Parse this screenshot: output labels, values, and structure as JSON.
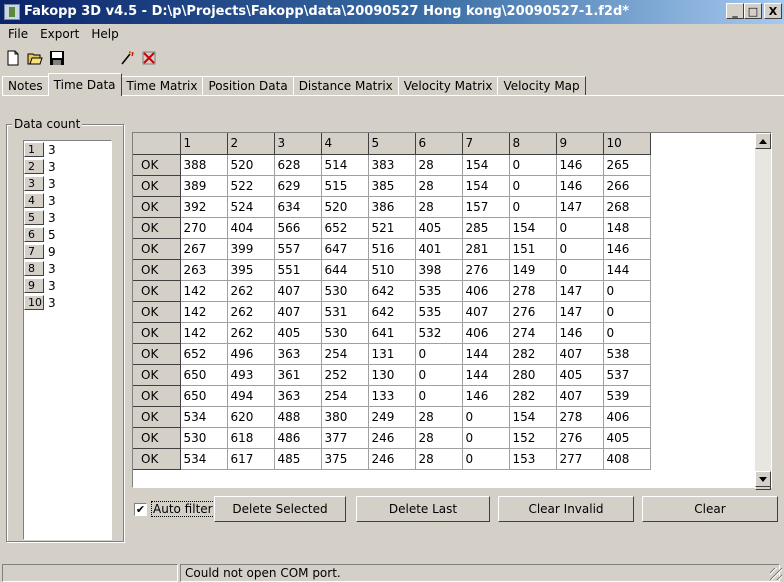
{
  "window": {
    "title": "Fakopp 3D v4.5 - D:\\p\\Projects\\Fakopp\\data\\20090527 Hong kong\\20090527-1.f2d*",
    "minimize": "_",
    "maximize": "□",
    "close": "X"
  },
  "menu": {
    "file": "File",
    "export": "Export",
    "help": "Help"
  },
  "toolbar": {
    "new_icon": "new-file-icon",
    "open_icon": "open-folder-icon",
    "save_icon": "save-disk-icon",
    "wand_icon": "connect-icon",
    "disconnect_icon": "disconnect-icon"
  },
  "tabs": [
    {
      "label": "Notes",
      "active": false
    },
    {
      "label": "Time Data",
      "active": true
    },
    {
      "label": "Time Matrix",
      "active": false
    },
    {
      "label": "Position Data",
      "active": false
    },
    {
      "label": "Distance Matrix",
      "active": false
    },
    {
      "label": "Velocity Matrix",
      "active": false
    },
    {
      "label": "Velocity Map",
      "active": false
    }
  ],
  "data_count": {
    "label": "Data count",
    "rows": [
      {
        "idx": "1",
        "val": "3"
      },
      {
        "idx": "2",
        "val": "3"
      },
      {
        "idx": "3",
        "val": "3"
      },
      {
        "idx": "4",
        "val": "3"
      },
      {
        "idx": "5",
        "val": "3"
      },
      {
        "idx": "6",
        "val": "5"
      },
      {
        "idx": "7",
        "val": "9"
      },
      {
        "idx": "8",
        "val": "3"
      },
      {
        "idx": "9",
        "val": "3"
      },
      {
        "idx": "10",
        "val": "3"
      }
    ]
  },
  "grid": {
    "headers": [
      "1",
      "2",
      "3",
      "4",
      "5",
      "6",
      "7",
      "8",
      "9",
      "10"
    ],
    "rows": [
      {
        "status": "OK",
        "values": [
          "388",
          "520",
          "628",
          "514",
          "383",
          "28",
          "154",
          "0",
          "146",
          "265"
        ]
      },
      {
        "status": "OK",
        "values": [
          "389",
          "522",
          "629",
          "515",
          "385",
          "28",
          "154",
          "0",
          "146",
          "266"
        ]
      },
      {
        "status": "OK",
        "values": [
          "392",
          "524",
          "634",
          "520",
          "386",
          "28",
          "157",
          "0",
          "147",
          "268"
        ]
      },
      {
        "status": "OK",
        "values": [
          "270",
          "404",
          "566",
          "652",
          "521",
          "405",
          "285",
          "154",
          "0",
          "148"
        ]
      },
      {
        "status": "OK",
        "values": [
          "267",
          "399",
          "557",
          "647",
          "516",
          "401",
          "281",
          "151",
          "0",
          "146"
        ]
      },
      {
        "status": "OK",
        "values": [
          "263",
          "395",
          "551",
          "644",
          "510",
          "398",
          "276",
          "149",
          "0",
          "144"
        ]
      },
      {
        "status": "OK",
        "values": [
          "142",
          "262",
          "407",
          "530",
          "642",
          "535",
          "406",
          "278",
          "147",
          "0"
        ]
      },
      {
        "status": "OK",
        "values": [
          "142",
          "262",
          "407",
          "531",
          "642",
          "535",
          "407",
          "276",
          "147",
          "0"
        ]
      },
      {
        "status": "OK",
        "values": [
          "142",
          "262",
          "405",
          "530",
          "641",
          "532",
          "406",
          "274",
          "146",
          "0"
        ]
      },
      {
        "status": "OK",
        "values": [
          "652",
          "496",
          "363",
          "254",
          "131",
          "0",
          "144",
          "282",
          "407",
          "538"
        ]
      },
      {
        "status": "OK",
        "values": [
          "650",
          "493",
          "361",
          "252",
          "130",
          "0",
          "144",
          "280",
          "405",
          "537"
        ]
      },
      {
        "status": "OK",
        "values": [
          "650",
          "494",
          "363",
          "254",
          "133",
          "0",
          "146",
          "282",
          "407",
          "539"
        ]
      },
      {
        "status": "OK",
        "values": [
          "534",
          "620",
          "488",
          "380",
          "249",
          "28",
          "0",
          "154",
          "278",
          "406"
        ]
      },
      {
        "status": "OK",
        "values": [
          "530",
          "618",
          "486",
          "377",
          "246",
          "28",
          "0",
          "152",
          "276",
          "405"
        ]
      },
      {
        "status": "OK",
        "values": [
          "534",
          "617",
          "485",
          "375",
          "246",
          "28",
          "0",
          "153",
          "277",
          "408"
        ]
      }
    ]
  },
  "controls": {
    "auto_filter_label": "Auto filter",
    "auto_filter_checked": true,
    "delete_selected": "Delete Selected",
    "delete_last": "Delete Last",
    "clear_invalid": "Clear Invalid",
    "clear": "Clear"
  },
  "status": {
    "pane1": "",
    "message": "Could not open COM port."
  }
}
